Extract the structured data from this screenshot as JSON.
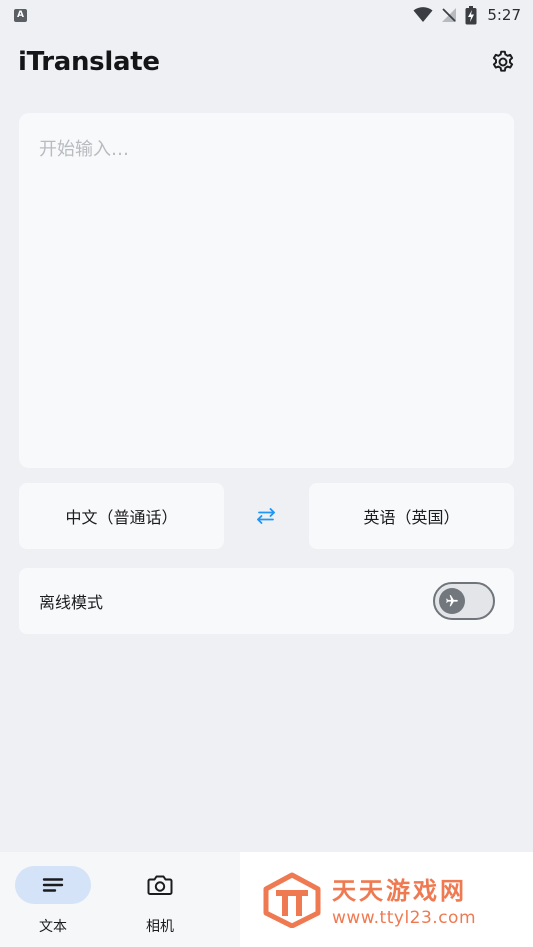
{
  "status_bar": {
    "notification_icon": "a-icon",
    "notification_letter": "A",
    "time": "5:27",
    "icons": [
      "wifi-icon",
      "no-signal-icon",
      "battery-charging-icon"
    ]
  },
  "app_bar": {
    "title": "iTranslate",
    "settings_icon": "gear-icon"
  },
  "input": {
    "placeholder": "开始输入…",
    "value": ""
  },
  "languages": {
    "source": "中文（普通话）",
    "target": "英语（英国）",
    "swap_icon": "swap-arrows-icon",
    "accent_color": "#2196f3"
  },
  "offline": {
    "label": "离线模式",
    "enabled": false,
    "toggle_icon": "airplane-icon"
  },
  "bottom_nav": {
    "items": [
      {
        "label": "文本",
        "icon": "text-lines-icon",
        "active": true
      },
      {
        "label": "相机",
        "icon": "camera-icon",
        "active": false
      }
    ]
  },
  "watermark": {
    "title": "天天游戏网",
    "url": "www.ttyl23.com",
    "color": "#ef7a52"
  }
}
